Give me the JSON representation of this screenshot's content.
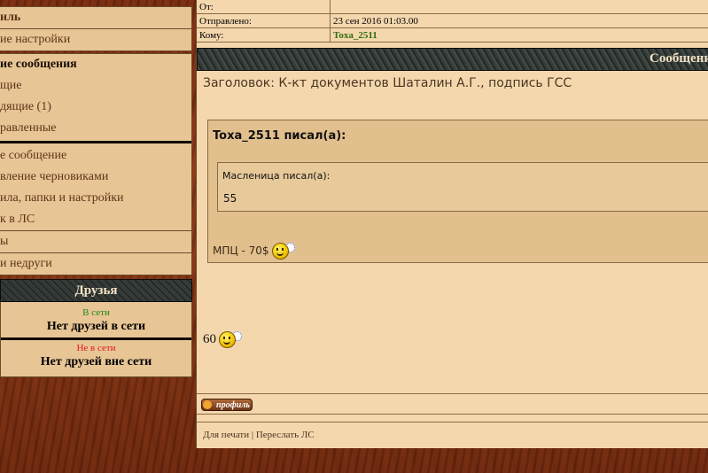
{
  "sidebar": {
    "menu1": [
      "иль",
      "ие настройки"
    ],
    "menu2": [
      "ие сообщения",
      "щие",
      "дящие (1)",
      "равленные"
    ],
    "menu3": [
      "е сообщение",
      "вление черновиками",
      "ила, папки и настройки",
      "к в ЛС"
    ],
    "menu4": [
      "ы",
      "и недруги"
    ]
  },
  "friends": {
    "title": "Друзья",
    "online_label": "В сети",
    "online_empty": "Нет друзей в сети",
    "offline_label": "Не в сети",
    "offline_empty": "Нет друзей вне сети",
    "colors": {
      "online": "#1c8a17",
      "offline": "#e2161a"
    }
  },
  "message": {
    "from_label": "От:",
    "sent_label": "Отправлено:",
    "sent_value": "23 сен 2016 01:03.00",
    "to_label": "Кому:",
    "to_value": "Toxa_2511",
    "header_title": "Сообщени",
    "subject": "Заголовок: К-кт документов Шаталин А.Г., подпись ГСС",
    "quote_author": "Toxa_2511 писал(а):",
    "inner_quote_author": "Масленица писал(а):",
    "inner_quote_text": "55",
    "quote_text": "МПЦ - 70$",
    "body_text": "60",
    "profile_button": "профиль",
    "print_link": "Для печати",
    "link_sep": "|",
    "forward_link": "Переслать ЛС"
  }
}
